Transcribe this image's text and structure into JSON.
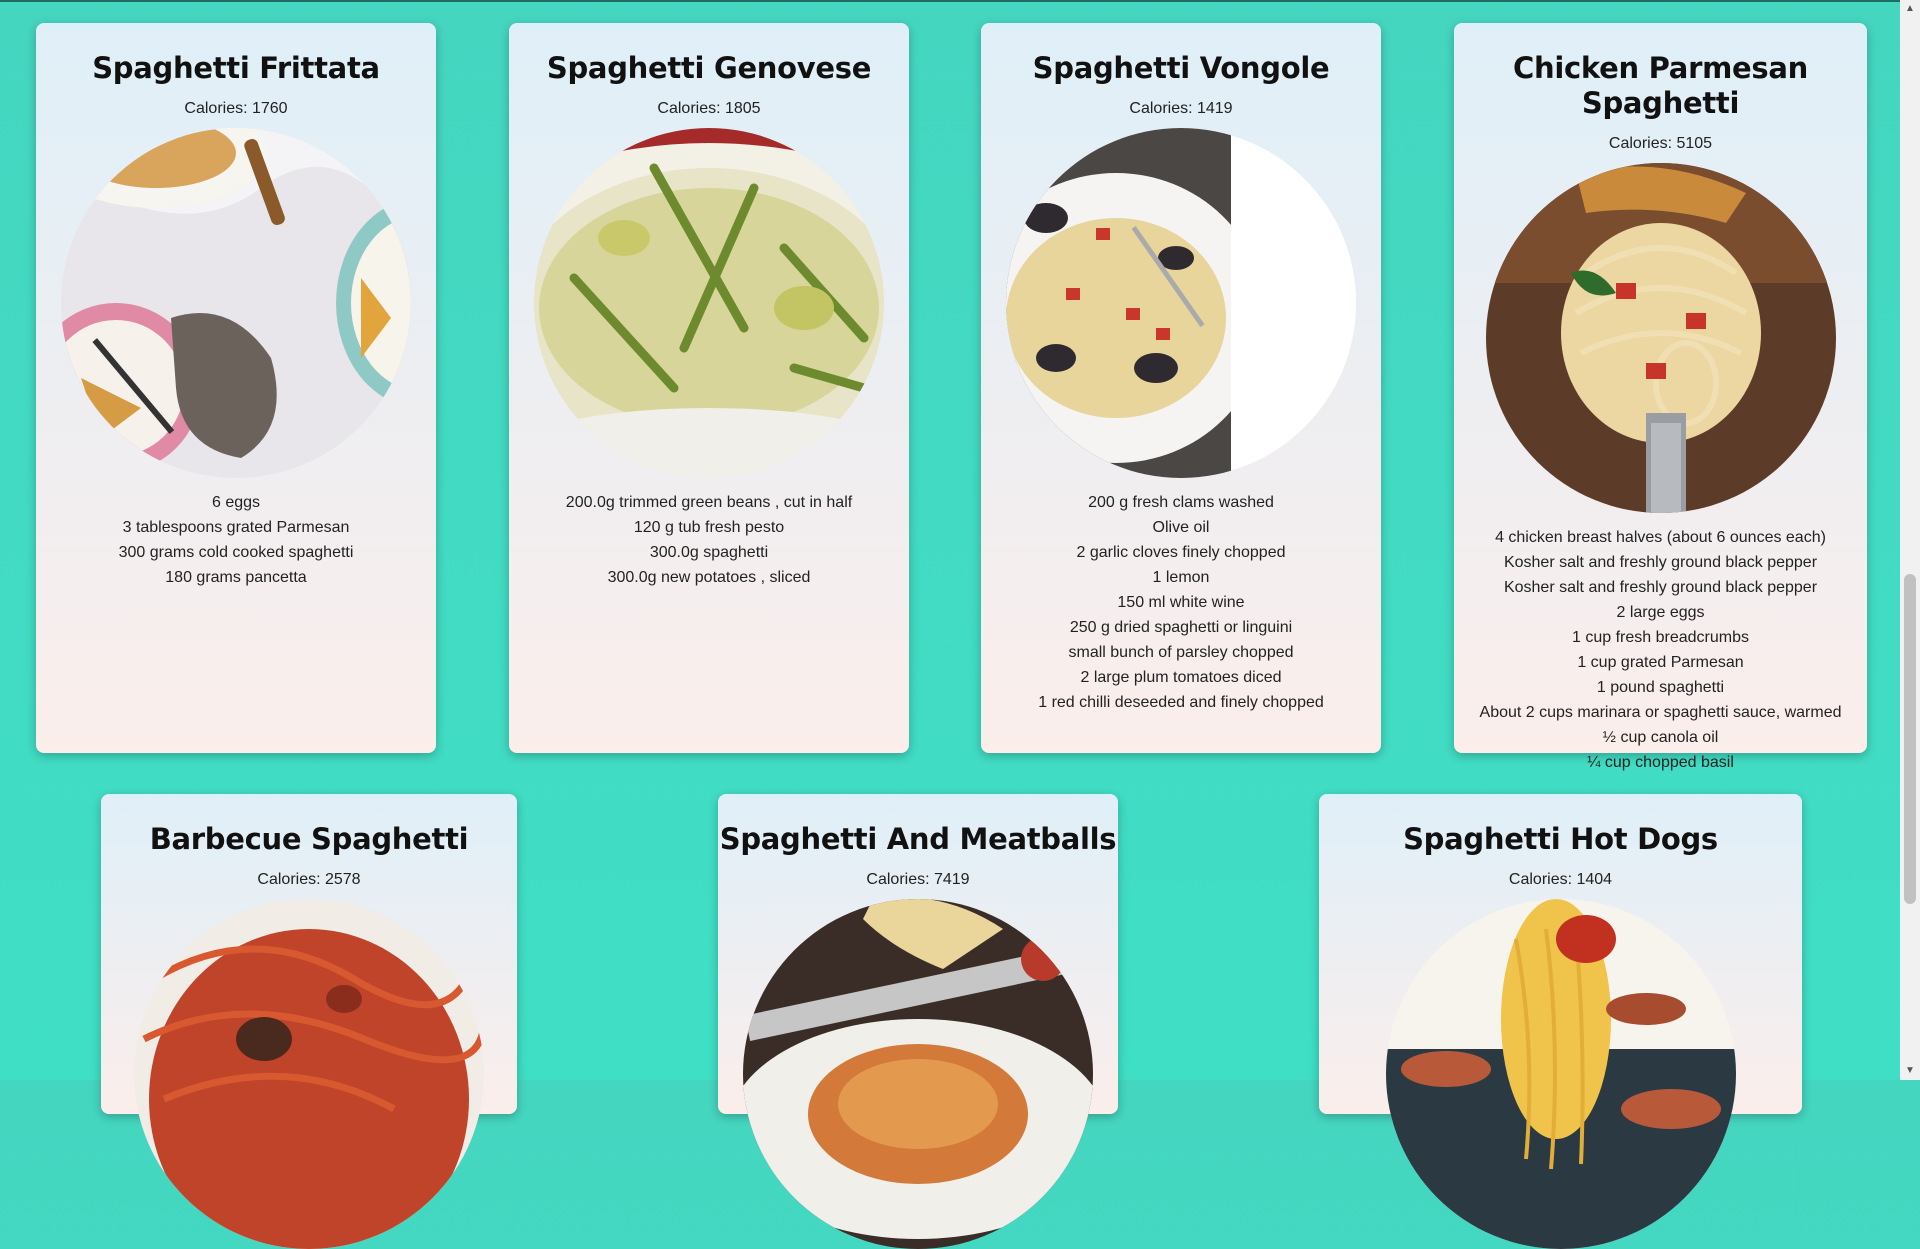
{
  "recipes": [
    {
      "title": "Spaghetti Frittata",
      "calories": "Calories: 1760",
      "ingredients": [
        "6 eggs",
        "3 tablespoons grated Parmesan",
        "300 grams cold cooked spaghetti",
        "180 grams pancetta"
      ]
    },
    {
      "title": "Spaghetti Genovese",
      "calories": "Calories: 1805",
      "ingredients": [
        "200.0g trimmed green beans , cut in half",
        "120 g tub fresh pesto",
        "300.0g spaghetti",
        "300.0g new potatoes , sliced"
      ]
    },
    {
      "title": "Spaghetti Vongole",
      "calories": "Calories: 1419",
      "ingredients": [
        "200 g fresh clams washed",
        "Olive oil",
        "2 garlic cloves finely chopped",
        "1 lemon",
        "150 ml white wine",
        "250 g dried spaghetti or linguini",
        "small bunch of parsley chopped",
        "2 large plum tomatoes diced",
        "1 red chilli deseeded and finely chopped"
      ]
    },
    {
      "title": "Chicken Parmesan Spaghetti",
      "calories": "Calories: 5105",
      "ingredients": [
        "4 chicken breast halves (about 6 ounces each)",
        "Kosher salt and freshly ground black pepper",
        "Kosher salt and freshly ground black pepper",
        "2 large eggs",
        "1 cup fresh breadcrumbs",
        "1 cup grated Parmesan",
        "1 pound spaghetti",
        "About 2 cups marinara or spaghetti sauce, warmed",
        "½ cup canola oil",
        "¼ cup chopped basil"
      ]
    },
    {
      "title": "Barbecue Spaghetti",
      "calories": "Calories: 2578",
      "ingredients": []
    },
    {
      "title": "Spaghetti And Meatballs",
      "calories": "Calories: 7419",
      "ingredients": []
    },
    {
      "title": "Spaghetti Hot Dogs",
      "calories": "Calories: 1404",
      "ingredients": []
    }
  ]
}
